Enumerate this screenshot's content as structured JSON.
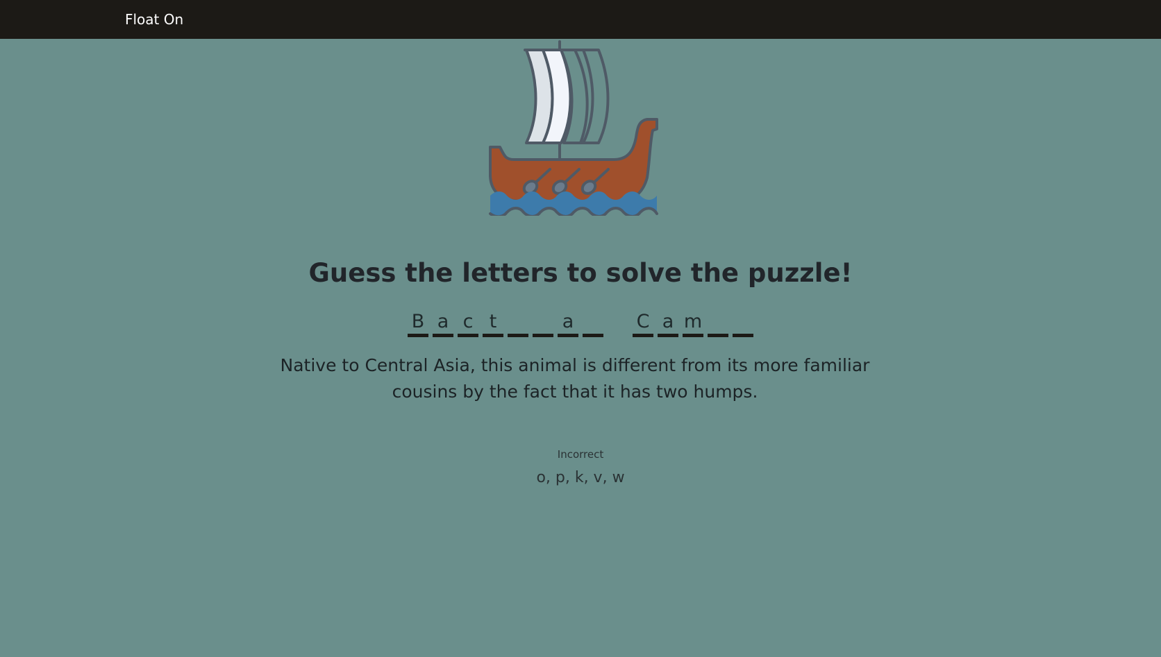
{
  "navbar": {
    "brand": "Float On"
  },
  "game": {
    "title": "Guess the letters to solve the puzzle!",
    "words": [
      [
        "B",
        "a",
        "c",
        "t",
        "",
        "",
        "a",
        ""
      ],
      [
        "C",
        "a",
        "m",
        "",
        ""
      ]
    ],
    "clue": "Native to Central Asia, this animal is different from its more familiar cousins by the fact that it has two humps.",
    "incorrect_label": "Incorrect",
    "incorrect_letters": "o, p, k, v, w"
  },
  "icons": {
    "ship": "viking-ship-icon"
  },
  "colors": {
    "background": "#6a8f8c",
    "navbar": "#1c1a16",
    "hull": "#a0502c",
    "water": "#3d7bab",
    "sail": "#f2f5fb",
    "outline": "#4f5a66"
  }
}
